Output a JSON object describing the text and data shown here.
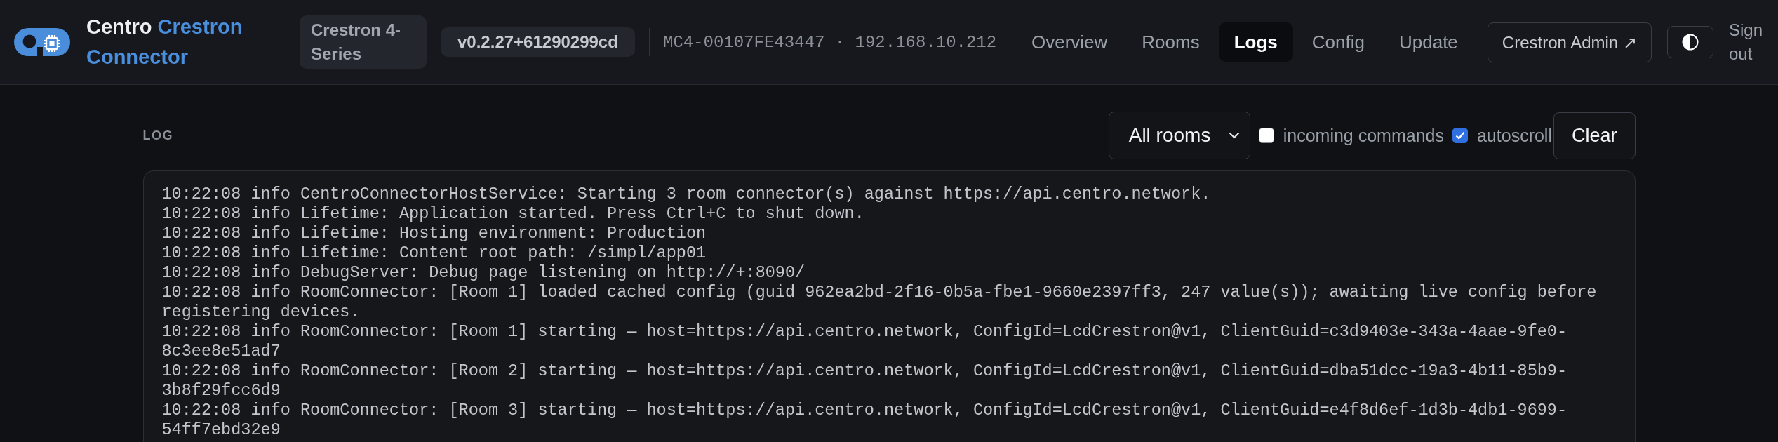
{
  "header": {
    "brand": {
      "name": "Centro",
      "product": "Crestron Connector"
    },
    "badges": [
      {
        "kind": "platform",
        "text": "Crestron 4-Series"
      },
      {
        "kind": "version",
        "text": "v0.2.27+61290299cd"
      }
    ],
    "device_info": "MC4-00107FE43447 · 192.168.10.212",
    "nav": [
      {
        "label": "Overview",
        "selected": false
      },
      {
        "label": "Rooms",
        "selected": false
      },
      {
        "label": "Logs",
        "selected": true
      },
      {
        "label": "Config",
        "selected": false
      },
      {
        "label": "Update",
        "selected": false
      }
    ],
    "admin_link": "Crestron Admin ↗",
    "sign_out": "Sign out"
  },
  "log": {
    "title": "LOG",
    "room_filter": "All rooms",
    "options": [
      {
        "label": "incoming commands",
        "checked": false
      },
      {
        "label": "autoscroll",
        "checked": true
      }
    ],
    "clear_button": "Clear",
    "lines": [
      "10:22:08 info CentroConnectorHostService: Starting 3 room connector(s) against https://api.centro.network.",
      "10:22:08 info Lifetime: Application started. Press Ctrl+C to shut down.",
      "10:22:08 info Lifetime: Hosting environment: Production",
      "10:22:08 info Lifetime: Content root path: /simpl/app01",
      "10:22:08 info DebugServer: Debug page listening on http://+:8090/",
      "10:22:08 info RoomConnector: [Room 1] loaded cached config (guid 962ea2bd-2f16-0b5a-fbe1-9660e2397ff3, 247 value(s)); awaiting live config before registering devices.",
      "10:22:08 info RoomConnector: [Room 1] starting — host=https://api.centro.network, ConfigId=LcdCrestron@v1, ClientGuid=c3d9403e-343a-4aae-9fe0-8c3ee8e51ad7",
      "10:22:08 info RoomConnector: [Room 2] starting — host=https://api.centro.network, ConfigId=LcdCrestron@v1, ClientGuid=dba51dcc-19a3-4b11-85b9-3b8f29fcc6d9",
      "10:22:08 info RoomConnector: [Room 3] starting — host=https://api.centro.network, ConfigId=LcdCrestron@v1, ClientGuid=e4f8d6ef-1d3b-4db1-9699-54ff7ebd32e9"
    ]
  }
}
